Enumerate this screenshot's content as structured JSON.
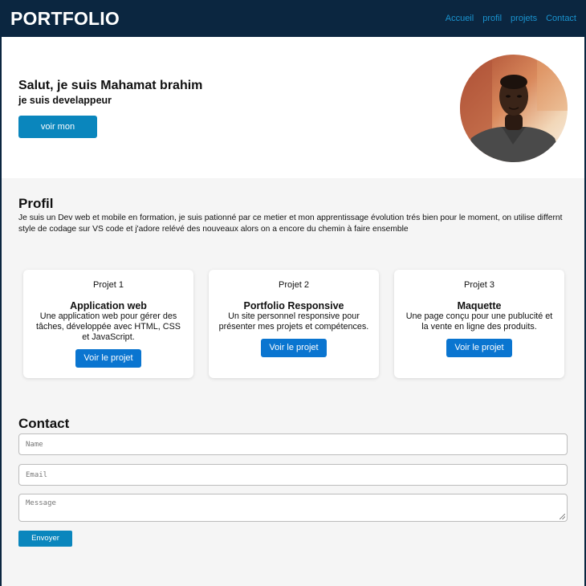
{
  "header": {
    "logo": "PORTFOLIO",
    "nav": [
      "Accueil",
      "profil",
      "projets",
      "Contact"
    ]
  },
  "hero": {
    "title": "Salut, je suis Mahamat brahim",
    "subtitle": "je suis develappeur",
    "button": "voir mon travail"
  },
  "profil": {
    "heading": "Profil",
    "text": "Je suis un Dev web et mobile en formation, je suis pationné par ce metier et mon apprentissage évolution trés bien pour le moment, on utilise differnt style de codage sur VS code et j'adore relévé des nouveaux alors on a encore du chemin à faire ensemble"
  },
  "projects": [
    {
      "number": "Projet 1",
      "title": "Application web",
      "description": "Une application web pour gérer des tâches, développée avec HTML, CSS et JavaScript.",
      "button": "Voir le projet"
    },
    {
      "number": "Projet 2",
      "title": "Portfolio Responsive",
      "description": "Un site personnel responsive pour présenter mes projets et compétences.",
      "button": "Voir le projet"
    },
    {
      "number": "Projet 3",
      "title": "Maquette",
      "description": "Une page conçu pour une publucité et la vente en ligne des produits.",
      "button": "Voir le projet"
    }
  ],
  "contact": {
    "heading": "Contact",
    "name_placeholder": "Name",
    "email_placeholder": "Email",
    "message_placeholder": "Message",
    "button": "Envoyer"
  },
  "colors": {
    "header_bg": "#0b2640",
    "nav_link": "#1a93cf",
    "accent_button": "#0a86bd",
    "card_button": "#0a75d0"
  }
}
